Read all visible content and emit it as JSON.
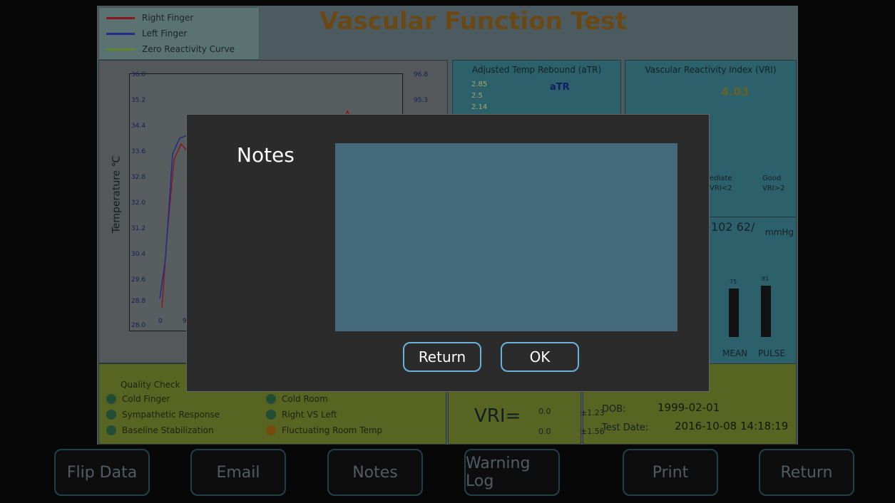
{
  "app": {
    "title": "Vascular Function Test",
    "legend": [
      {
        "label": "Right Finger",
        "color": "#c0202a"
      },
      {
        "label": "Left  Finger",
        "color": "#2a3fbf"
      },
      {
        "label": "Zero Reactivity Curve",
        "color": "#7fbf3f"
      }
    ],
    "temp_chart": {
      "ylabel": "Temperature ℃",
      "left_ticks": [
        "36.0",
        "35.2",
        "34.4",
        "33.6",
        "32.8",
        "32.0",
        "31.2",
        "30.4",
        "29.6",
        "28.8",
        "28.0"
      ],
      "right_ticks": [
        "96.8",
        "95.3"
      ],
      "x_ticks": [
        "0",
        "9"
      ]
    },
    "atr": {
      "title": "Adjusted Temp Rebound (aTR)",
      "series_label": "aTR",
      "ticks": [
        "2.85",
        "2.5",
        "2.14"
      ]
    },
    "vri_panel": {
      "title": "Vascular Reactivity Index (VRI)",
      "value": "4.03",
      "labels": [
        "ediate",
        "VRI<2",
        "Good",
        "VRI>2"
      ]
    },
    "bp": {
      "reading": "102 62",
      "sep": "/",
      "unit": "mmHg",
      "bar_values": [
        "75",
        "81"
      ],
      "labels": [
        "MEAN",
        "PULSE"
      ]
    },
    "quality": {
      "title": "Quality Check",
      "items": [
        {
          "label": "Cold Finger",
          "color": "#2f6b4a"
        },
        {
          "label": "Sympathetic Response",
          "color": "#2f6b4a"
        },
        {
          "label": "Baseline Stabilization",
          "color": "#2f6b4a"
        },
        {
          "label": "Cold Room",
          "color": "#2f6b4a"
        },
        {
          "label": "Right VS Left",
          "color": "#2f6b4a"
        },
        {
          "label": "Fluctuating Room Temp",
          "color": "#a06a10"
        }
      ]
    },
    "vri_result": {
      "label": "VRI=",
      "v1": "0.0",
      "v2": "0.0",
      "pm1": "±1.23",
      "pm2": "±1.56"
    },
    "patient": {
      "dob_label": "DOB:",
      "dob": "1999-02-01",
      "test_date_label": "Test Date:",
      "test_date": "2016-10-08 14:18:19"
    }
  },
  "bottom_buttons": [
    "Flip Data",
    "Email",
    "Notes",
    "Warning Log",
    "Print",
    "Return"
  ],
  "dialog": {
    "label": "Notes",
    "text_value": "",
    "return_label": "Return",
    "ok_label": "OK"
  }
}
